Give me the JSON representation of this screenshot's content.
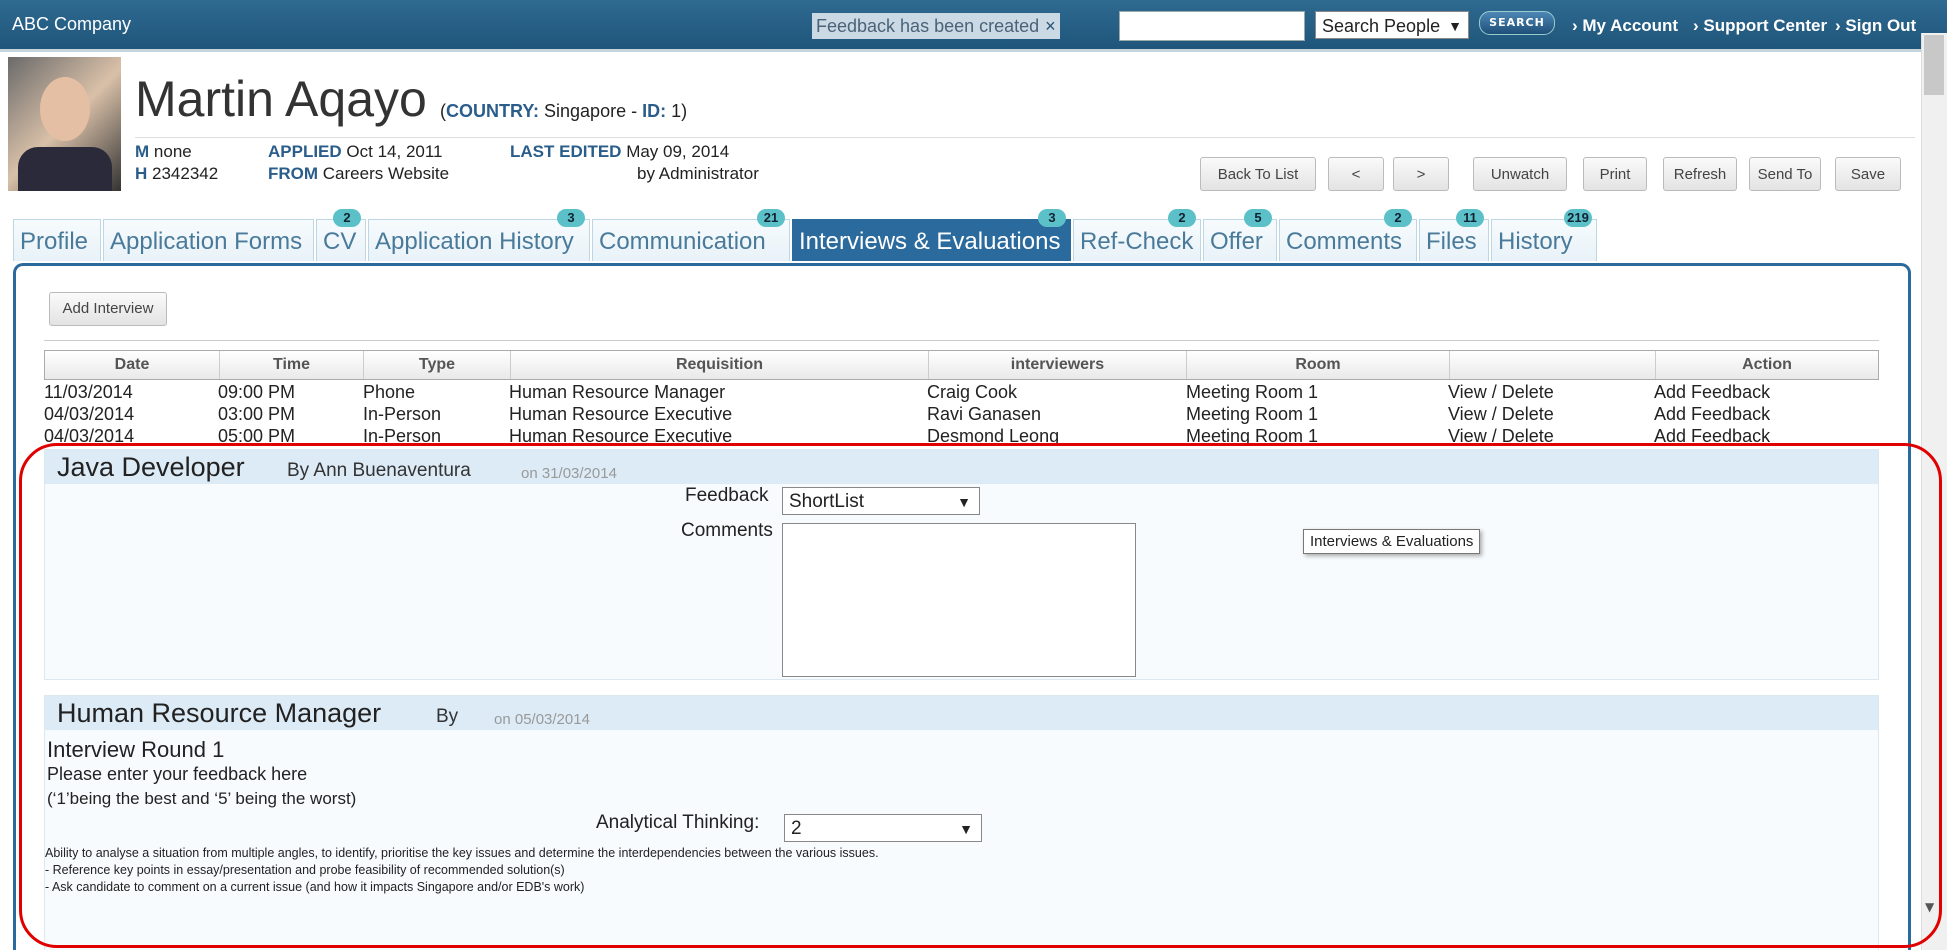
{
  "topbar": {
    "company": "ABC Company",
    "notification": "Feedback has been created",
    "notification_close": "×",
    "search_value": "",
    "search_scope": "Search People",
    "search_button": "SEARCH",
    "links": [
      "› My Account",
      "› Support Center",
      "› Sign Out"
    ]
  },
  "candidate": {
    "name": "Martin Aqayo",
    "country_label": "COUNTRY:",
    "country": "Singapore",
    "id_label": "ID:",
    "id": "1",
    "m_label": "M",
    "m_value": "none",
    "h_label": "H",
    "h_value": "2342342",
    "applied_label": "APPLIED",
    "applied": "Oct 14, 2011",
    "from_label": "FROM",
    "from": "Careers Website",
    "last_edited_label": "LAST EDITED",
    "last_edited": "May 09, 2014",
    "edited_by": "by Administrator"
  },
  "actions": [
    "Back To List",
    "<",
    ">",
    "Unwatch",
    "Print",
    "Refresh",
    "Send To",
    "Save"
  ],
  "tabs": [
    {
      "label": "Profile",
      "badge": ""
    },
    {
      "label": "Application Forms",
      "badge": ""
    },
    {
      "label": "CV",
      "badge": "2"
    },
    {
      "label": "Application History",
      "badge": "3"
    },
    {
      "label": "Communication",
      "badge": "21"
    },
    {
      "label": "Interviews & Evaluations",
      "badge": "3"
    },
    {
      "label": "Ref-Check",
      "badge": "2"
    },
    {
      "label": "Offer",
      "badge": "5"
    },
    {
      "label": "Comments",
      "badge": "2"
    },
    {
      "label": "Files",
      "badge": "11"
    },
    {
      "label": "History",
      "badge": "219"
    }
  ],
  "add_interview": "Add Interview",
  "table": {
    "headers": [
      "Date",
      "Time",
      "Type",
      "Requisition",
      "interviewers",
      "Room",
      "",
      "Action"
    ],
    "rows": [
      {
        "date": "11/03/2014",
        "time": "09:00 PM",
        "type": "Phone",
        "requisition": "Human Resource Manager",
        "interviewer": "Craig Cook",
        "room": "Meeting Room 1",
        "view_delete": "View / Delete",
        "action": "Add Feedback"
      },
      {
        "date": "04/03/2014",
        "time": "03:00 PM",
        "type": "In-Person",
        "requisition": "Human Resource Executive",
        "interviewer": "Ravi Ganasen",
        "room": "Meeting Room 1",
        "view_delete": "View / Delete",
        "action": "Add Feedback"
      },
      {
        "date": "04/03/2014",
        "time": "05:00 PM",
        "type": "In-Person",
        "requisition": "Human Resource Executive",
        "interviewer": "Desmond Leong",
        "room": "Meeting Room 1",
        "view_delete": "View / Delete",
        "action": "Add Feedback"
      }
    ]
  },
  "panel1": {
    "title": "Java Developer",
    "by": "By Ann Buenaventura",
    "on": "on 31/03/2014",
    "feedback_label": "Feedback",
    "feedback_value": "ShortList",
    "comments_label": "Comments",
    "comments_value": "",
    "tooltip": "Interviews & Evaluations"
  },
  "panel2": {
    "title": "Human Resource Manager",
    "by": "By",
    "on": "on 05/03/2014",
    "round": "Interview Round 1",
    "instruction": "Please enter your feedback here",
    "scale": "(‘1’being the best and ‘5’ being the worst)",
    "criterion_label": "Analytical Thinking:",
    "criterion_value": "2",
    "desc": [
      "Ability to analyse a situation from multiple angles, to identify, prioritise the key issues and determine the interdependencies between the various issues.",
      "- Reference  key points in essay/presentation and probe feasibility of recommended solution(s)",
      "- Ask candidate to comment on a current issue (and how it impacts Singapore and/or EDB's work)"
    ]
  },
  "colors": {
    "brand": "#1f557a",
    "active_tab": "#2a6a9c",
    "badge": "#5bc0c8",
    "highlight": "#e00000"
  }
}
